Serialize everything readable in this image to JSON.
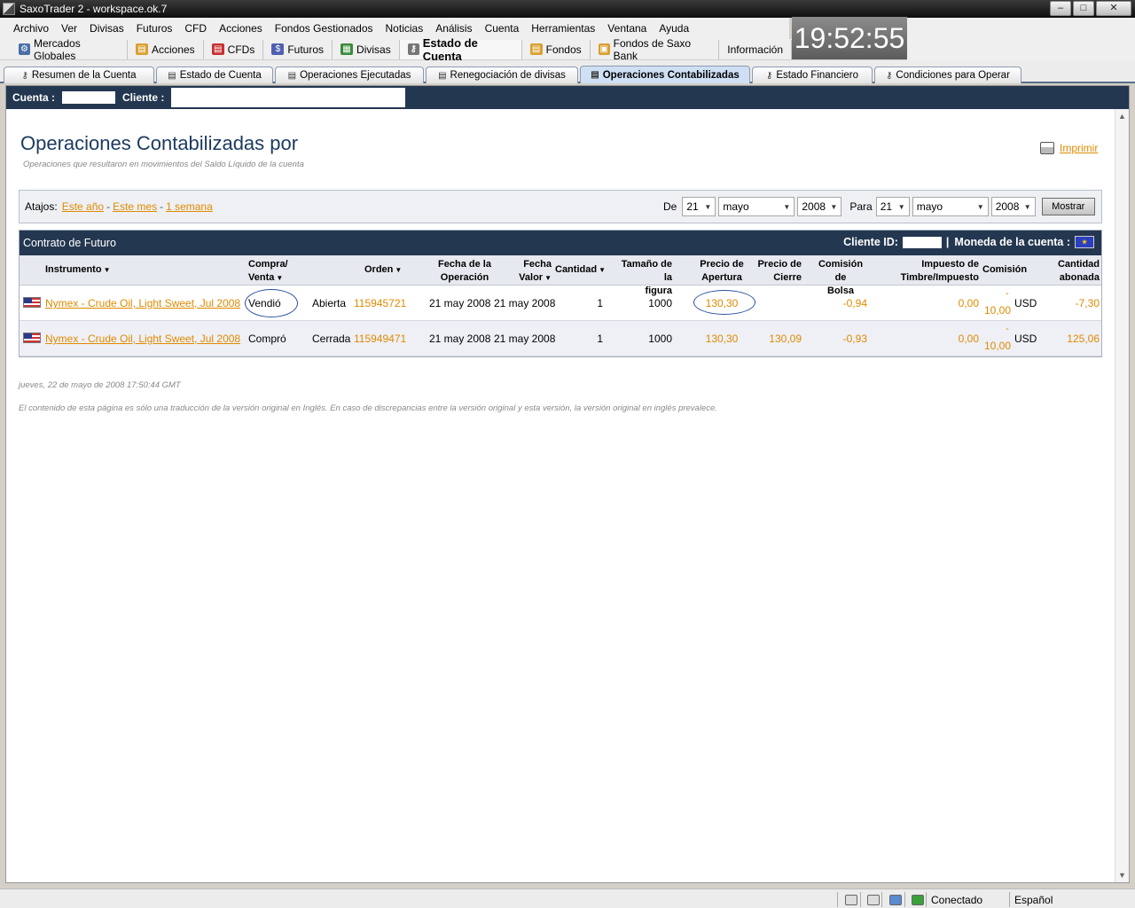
{
  "window": {
    "title": "SaxoTrader 2 - workspace.ok.7",
    "min": "–",
    "max": "□",
    "close": "✕"
  },
  "menu": [
    "Archivo",
    "Ver",
    "Divisas",
    "Futuros",
    "CFD",
    "Acciones",
    "Fondos Gestionados",
    "Noticias",
    "Análisis",
    "Cuenta",
    "Herramientas",
    "Ventana",
    "Ayuda"
  ],
  "clock": "19:52:55",
  "modules": [
    {
      "label": "Mercados Globales",
      "icon": "gear-icon",
      "color": "#4a6fa5"
    },
    {
      "label": "Acciones",
      "icon": "stocks-icon",
      "color": "#d8a030"
    },
    {
      "label": "CFDs",
      "icon": "cfd-icon",
      "color": "#c83030"
    },
    {
      "label": "Futuros",
      "icon": "futures-icon",
      "color": "#5060b0"
    },
    {
      "label": "Divisas",
      "icon": "forex-icon",
      "color": "#3a8a3a"
    },
    {
      "label": "Estado de Cuenta",
      "icon": "account-icon",
      "color": "#777777"
    },
    {
      "label": "Fondos",
      "icon": "funds-icon",
      "color": "#d8a030"
    },
    {
      "label": "Fondos de Saxo Bank",
      "icon": "saxo-funds-icon",
      "color": "#d8a030"
    },
    {
      "label": "Información",
      "icon": "",
      "color": ""
    }
  ],
  "tabs": [
    "Resumen de la Cuenta",
    "Estado de Cuenta",
    "Operaciones Ejecutadas",
    "Renegociación de divisas",
    "Operaciones Contabilizadas",
    "Estado Financiero",
    "Condiciones para Operar"
  ],
  "account_bar": {
    "account_label": "Cuenta :",
    "client_label": "Cliente :"
  },
  "page": {
    "title": "Operaciones Contabilizadas por",
    "subtitle": "Operaciones que resultaron en movimientos del Saldo Líquido de la cuenta",
    "print": "Imprimir"
  },
  "filter": {
    "shortcuts_label": "Atajos:",
    "this_year": "Este año",
    "this_month": "Este mes",
    "one_week": "1 semana",
    "sep": "-",
    "from_label": "De",
    "from_day": "21",
    "from_month": "mayo",
    "from_year": "2008",
    "to_label": "Para",
    "to_day": "21",
    "to_month": "mayo",
    "to_year": "2008",
    "show_button": "Mostrar"
  },
  "table": {
    "title": "Contrato de Futuro",
    "client_id_label": "Cliente ID:",
    "pipe": "|",
    "currency_label": "Moneda de la cuenta :",
    "columns": {
      "instrument": "Instrumento",
      "side": [
        "Compra/",
        "Venta"
      ],
      "order": "Orden",
      "trade_date": [
        "Fecha de la",
        "Operación"
      ],
      "value_date": [
        "Fecha",
        "Valor"
      ],
      "quantity": "Cantidad",
      "size": [
        "Tamaño de la",
        "figura"
      ],
      "open_price": [
        "Precio de",
        "Apertura"
      ],
      "close_price": [
        "Precio de",
        "Cierre"
      ],
      "exchange_fee": [
        "Comisión de",
        "Bolsa"
      ],
      "stamp_tax": [
        "Impuesto de",
        "Timbre/Impuesto"
      ],
      "commission": "Comisión",
      "credited": [
        "Cantidad",
        "abonada"
      ]
    },
    "rows": [
      {
        "instrument": "Nymex - Crude Oil, Light Sweet, Jul 2008",
        "side": "Vendió",
        "status": "Abierta",
        "order": "115945721",
        "trade_date": "21 may 2008",
        "value_date": "21 may 2008",
        "quantity": "1",
        "size": "1000",
        "open_price": "130,30",
        "close_price": "",
        "exchange_fee": "-0,94",
        "stamp_tax": "0,00",
        "commission_sign": "-",
        "commission": "10,00",
        "currency": "USD",
        "credited": "-7,30"
      },
      {
        "instrument": "Nymex - Crude Oil, Light Sweet, Jul 2008",
        "side": "Compró",
        "status": "Cerrada",
        "order": "115949471",
        "trade_date": "21 may 2008",
        "value_date": "21 may 2008",
        "quantity": "1",
        "size": "1000",
        "open_price": "130,30",
        "close_price": "130,09",
        "exchange_fee": "-0,93",
        "stamp_tax": "0,00",
        "commission_sign": "-",
        "commission": "10,00",
        "currency": "USD",
        "credited": "125,06"
      }
    ]
  },
  "footer": {
    "date": "jueves, 22 de mayo de 2008 17:50:44 GMT",
    "note": "El contenido de esta página es sólo una traducción de la versión original en Inglés. En caso de discrepancias entre la versión original y esta versión, la versión original en inglés prevalece."
  },
  "status": {
    "connection": "Conectado",
    "language": "Español"
  },
  "colors": {
    "navy": "#243750",
    "link": "#e08a00"
  }
}
